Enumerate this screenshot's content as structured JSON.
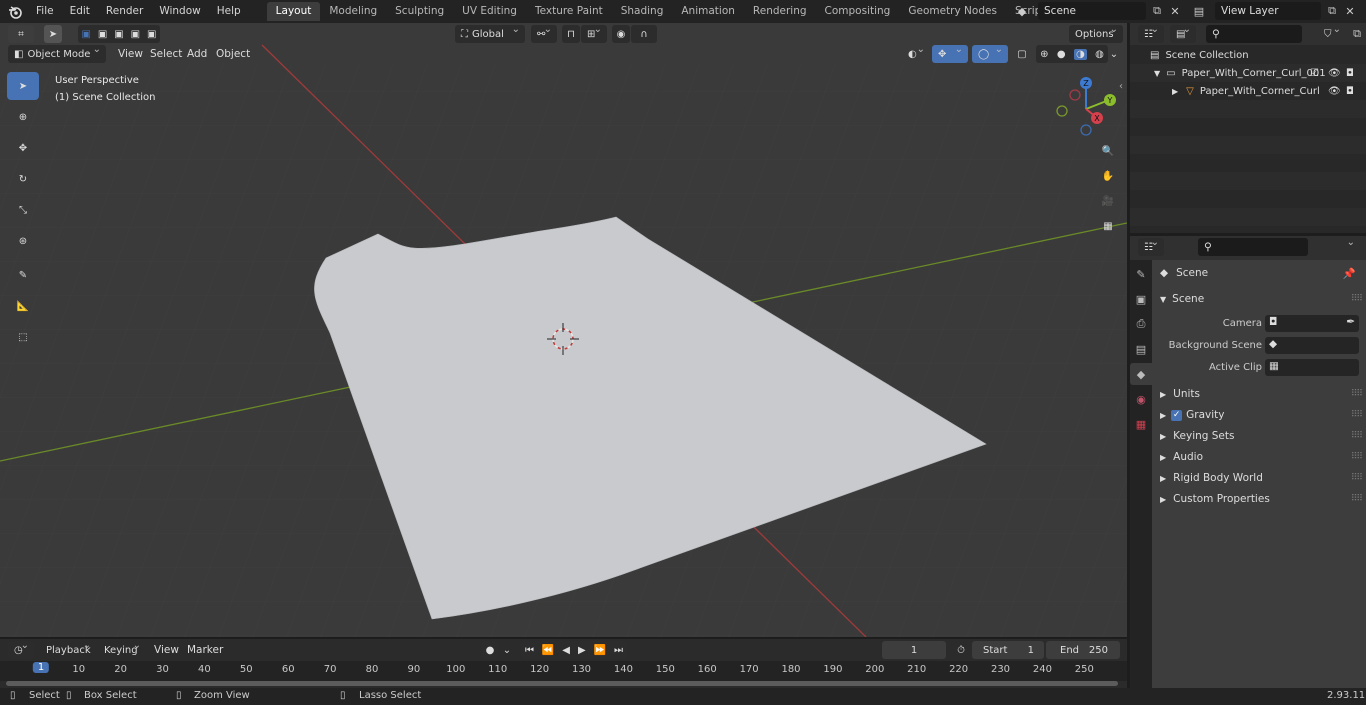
{
  "menu": [
    "File",
    "Edit",
    "Render",
    "Window",
    "Help"
  ],
  "workspace_tabs": [
    {
      "label": "Layout",
      "active": true
    },
    {
      "label": "Modeling",
      "active": false
    },
    {
      "label": "Sculpting",
      "active": false
    },
    {
      "label": "UV Editing",
      "active": false
    },
    {
      "label": "Texture Paint",
      "active": false
    },
    {
      "label": "Shading",
      "active": false
    },
    {
      "label": "Animation",
      "active": false
    },
    {
      "label": "Rendering",
      "active": false
    },
    {
      "label": "Compositing",
      "active": false
    },
    {
      "label": "Geometry Nodes",
      "active": false
    },
    {
      "label": "Scripting",
      "active": false
    }
  ],
  "scene_name": "Scene",
  "view_layer": "View Layer",
  "viewport": {
    "mode": "Object Mode",
    "menus": [
      "View",
      "Select",
      "Add",
      "Object"
    ],
    "orientation": "Global",
    "options_label": "Options",
    "overlay_line1": "User Perspective",
    "overlay_line2": "(1) Scene Collection",
    "gizmo": {
      "x": "X",
      "y": "Y",
      "z": "Z"
    }
  },
  "colors": {
    "accent": "#4772b3",
    "x_axis": "#b04040",
    "y_axis": "#6e8f28",
    "mesh": "#c8cacd",
    "viewport_bg": "#3a3a3a"
  },
  "timeline": {
    "menus": [
      "Playback",
      "Keying",
      "View",
      "Marker"
    ],
    "current_frame": "1",
    "start_label": "Start",
    "start": "1",
    "end_label": "End",
    "end": "250",
    "ticks": [
      "1",
      "10",
      "20",
      "30",
      "40",
      "50",
      "60",
      "70",
      "80",
      "90",
      "100",
      "110",
      "120",
      "130",
      "140",
      "150",
      "160",
      "170",
      "180",
      "190",
      "200",
      "210",
      "220",
      "230",
      "240",
      "250"
    ]
  },
  "statusbar": {
    "select": "Select",
    "box_select": "Box Select",
    "zoom_view": "Zoom View",
    "lasso_select": "Lasso Select",
    "version": "2.93.11"
  },
  "outliner": {
    "root": "Scene Collection",
    "items": [
      {
        "label": "Paper_With_Corner_Curl_001",
        "level": 1
      },
      {
        "label": "Paper_With_Corner_Curl",
        "level": 2
      }
    ]
  },
  "properties": {
    "context": "Scene",
    "panel_title": "Scene",
    "fields": [
      {
        "label": "Camera",
        "value": ""
      },
      {
        "label": "Background Scene",
        "value": ""
      },
      {
        "label": "Active Clip",
        "value": ""
      }
    ],
    "subpanels": [
      "Units",
      "Gravity",
      "Keying Sets",
      "Audio",
      "Rigid Body World",
      "Custom Properties"
    ]
  }
}
